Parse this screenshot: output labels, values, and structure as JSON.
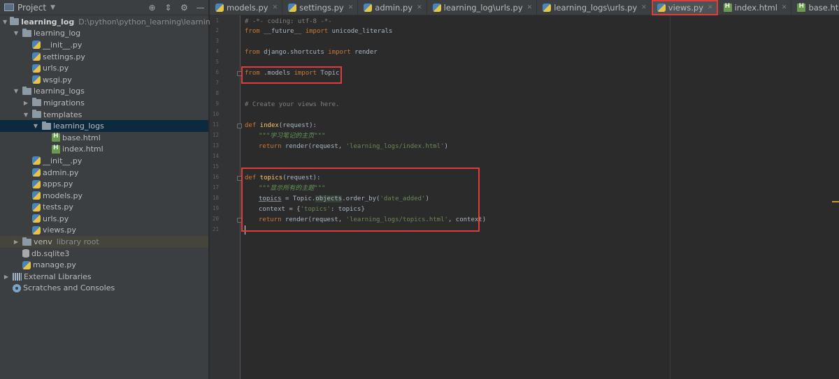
{
  "project_panel": {
    "title": "Project",
    "tree": [
      {
        "label": "learning_log",
        "secondary": "D:\\python\\python_learning\\learning_log",
        "icon": "folder-icon",
        "depth": 0,
        "expanded": true,
        "bold": true
      },
      {
        "label": "learning_log",
        "icon": "folder-icon",
        "depth": 1,
        "expanded": true
      },
      {
        "label": "__init__.py",
        "icon": "python-file-icon",
        "depth": 2
      },
      {
        "label": "settings.py",
        "icon": "python-file-icon",
        "depth": 2
      },
      {
        "label": "urls.py",
        "icon": "python-file-icon",
        "depth": 2
      },
      {
        "label": "wsgi.py",
        "icon": "python-file-icon",
        "depth": 2
      },
      {
        "label": "learning_logs",
        "icon": "folder-icon",
        "depth": 1,
        "expanded": true
      },
      {
        "label": "migrations",
        "icon": "folder-icon",
        "depth": 2,
        "expanded": false
      },
      {
        "label": "templates",
        "icon": "folder-icon",
        "depth": 2,
        "expanded": true
      },
      {
        "label": "learning_logs",
        "icon": "folder-icon",
        "depth": 3,
        "expanded": true,
        "selected": true
      },
      {
        "label": "base.html",
        "icon": "html-file-icon",
        "depth": 4
      },
      {
        "label": "index.html",
        "icon": "html-file-icon",
        "depth": 4
      },
      {
        "label": "__init__.py",
        "icon": "python-file-icon",
        "depth": 2
      },
      {
        "label": "admin.py",
        "icon": "python-file-icon",
        "depth": 2
      },
      {
        "label": "apps.py",
        "icon": "python-file-icon",
        "depth": 2
      },
      {
        "label": "models.py",
        "icon": "python-file-icon",
        "depth": 2
      },
      {
        "label": "tests.py",
        "icon": "python-file-icon",
        "depth": 2
      },
      {
        "label": "urls.py",
        "icon": "python-file-icon",
        "depth": 2
      },
      {
        "label": "views.py",
        "icon": "python-file-icon",
        "depth": 2
      },
      {
        "label": "venv",
        "secondary": "library root",
        "icon": "folder-icon",
        "depth": 1,
        "expanded": false,
        "libroot": true
      },
      {
        "label": "db.sqlite3",
        "icon": "database-icon",
        "depth": 1
      },
      {
        "label": "manage.py",
        "icon": "python-file-icon",
        "depth": 1
      },
      {
        "label": "External Libraries",
        "icon": "library-icon",
        "depth": 0,
        "expanded": false
      },
      {
        "label": "Scratches and Consoles",
        "icon": "scratch-icon",
        "depth": 0
      }
    ]
  },
  "tabs": [
    {
      "label": "models.py",
      "icon": "python-file-icon"
    },
    {
      "label": "settings.py",
      "icon": "python-file-icon"
    },
    {
      "label": "admin.py",
      "icon": "python-file-icon"
    },
    {
      "label": "learning_log\\urls.py",
      "icon": "python-file-icon"
    },
    {
      "label": "learning_logs\\urls.py",
      "icon": "python-file-icon"
    },
    {
      "label": "views.py",
      "icon": "python-file-icon",
      "active": true,
      "highlighted": true
    },
    {
      "label": "index.html",
      "icon": "html-file-icon"
    },
    {
      "label": "base.html",
      "icon": "html-file-icon"
    }
  ],
  "editor": {
    "line_numbers": [
      "1",
      "2",
      "3",
      "4",
      "5",
      "6",
      "7",
      "8",
      "9",
      "10",
      "11",
      "12",
      "13",
      "14",
      "15",
      "16",
      "17",
      "18",
      "19",
      "20",
      "21"
    ],
    "lines": {
      "l1": "# -*- coding: utf-8 -*-",
      "l2_kw": "from",
      "l2_mod": " __future__ ",
      "l2_kw2": "import",
      "l2_name": " unicode_literals",
      "l4_kw": "from",
      "l4_mod": " django.shortcuts ",
      "l4_kw2": "import",
      "l4_name": " render",
      "l6_kw": "from",
      "l6_mod": " .models ",
      "l6_kw2": "import",
      "l6_name": " Topic",
      "l9": "# Create your views here.",
      "l11_kw": "def",
      "l11_fn": " index",
      "l11_args": "(request):",
      "l12": "\"\"\"学习笔记的主页\"\"\"",
      "l13_kw": "return",
      "l13_a": " render(request, ",
      "l13_s": "'learning_logs/index.html'",
      "l13_b": ")",
      "l16_kw": "def",
      "l16_fn": " topics",
      "l16_args": "(request):",
      "l17": "\"\"\"显示所有的主题\"\"\"",
      "l18_a": "topics",
      "l18_b": " = Topic.",
      "l18_c": "objects",
      "l18_d": ".order_by(",
      "l18_s": "'date_added'",
      "l18_e": ")",
      "l19_a": "context = {",
      "l19_s": "'topics'",
      "l19_b": ": topics}",
      "l20_kw": "return",
      "l20_a": " render(request, ",
      "l20_s": "'learning_logs/topics.html'",
      "l20_b": ", context)"
    }
  }
}
